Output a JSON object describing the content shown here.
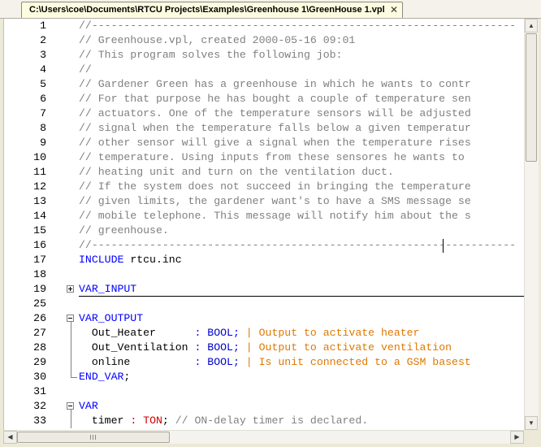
{
  "tab": {
    "title": "C:\\Users\\coe\\Documents\\RTCU Projects\\Examples\\Greenhouse 1\\GreenHouse 1.vpl",
    "close_glyph": "✕"
  },
  "editor": {
    "lines": [
      {
        "num": "1",
        "fold": "none",
        "tokens": [
          {
            "c": "comment",
            "t": "//------------------------------------------------------------------"
          }
        ]
      },
      {
        "num": "2",
        "fold": "none",
        "tokens": [
          {
            "c": "comment",
            "t": "// Greenhouse.vpl, created 2000-05-16 09:01"
          }
        ]
      },
      {
        "num": "3",
        "fold": "none",
        "tokens": [
          {
            "c": "comment",
            "t": "// This program solves the following job:"
          }
        ]
      },
      {
        "num": "4",
        "fold": "none",
        "tokens": [
          {
            "c": "comment",
            "t": "//"
          }
        ]
      },
      {
        "num": "5",
        "fold": "none",
        "tokens": [
          {
            "c": "comment",
            "t": "// Gardener Green has a greenhouse in which he wants to contr"
          }
        ]
      },
      {
        "num": "6",
        "fold": "none",
        "tokens": [
          {
            "c": "comment",
            "t": "// For that purpose he has bought a couple of temperature sen"
          }
        ]
      },
      {
        "num": "7",
        "fold": "none",
        "tokens": [
          {
            "c": "comment",
            "t": "// actuators. One of the temperature sensors will be adjusted"
          }
        ]
      },
      {
        "num": "8",
        "fold": "none",
        "tokens": [
          {
            "c": "comment",
            "t": "// signal when the temperature falls below a given temperatur"
          }
        ]
      },
      {
        "num": "9",
        "fold": "none",
        "tokens": [
          {
            "c": "comment",
            "t": "// other sensor will give a signal when the temperature rises"
          }
        ]
      },
      {
        "num": "10",
        "fold": "none",
        "tokens": [
          {
            "c": "comment",
            "t": "// temperature. Using inputs from these sensores he wants to "
          }
        ]
      },
      {
        "num": "11",
        "fold": "none",
        "tokens": [
          {
            "c": "comment",
            "t": "// heating unit and turn on the ventilation duct."
          }
        ]
      },
      {
        "num": "12",
        "fold": "none",
        "tokens": [
          {
            "c": "comment",
            "t": "// If the system does not succeed in bringing the temperature"
          }
        ]
      },
      {
        "num": "13",
        "fold": "none",
        "tokens": [
          {
            "c": "comment",
            "t": "// given limits, the gardener want's to have a SMS message se"
          }
        ]
      },
      {
        "num": "14",
        "fold": "none",
        "tokens": [
          {
            "c": "comment",
            "t": "// mobile telephone. This message will notify him about the s"
          }
        ]
      },
      {
        "num": "15",
        "fold": "none",
        "tokens": [
          {
            "c": "comment",
            "t": "// greenhouse."
          }
        ]
      },
      {
        "num": "16",
        "fold": "none",
        "tokens": [
          {
            "c": "comment",
            "t": "//------------------------------------------------------------------"
          }
        ]
      },
      {
        "num": "17",
        "fold": "none",
        "tokens": [
          {
            "c": "kw",
            "t": "INCLUDE"
          },
          {
            "c": "plain",
            "t": " rtcu.inc"
          }
        ]
      },
      {
        "num": "18",
        "fold": "none",
        "tokens": []
      },
      {
        "num": "19",
        "fold": "plus",
        "rule": true,
        "tokens": [
          {
            "c": "kw",
            "t": "VAR_INPUT"
          }
        ]
      },
      {
        "num": "25",
        "fold": "none",
        "tokens": []
      },
      {
        "num": "26",
        "fold": "minus",
        "tokens": [
          {
            "c": "kw",
            "t": "VAR_OUTPUT"
          }
        ]
      },
      {
        "num": "27",
        "fold": "line",
        "tokens": [
          {
            "c": "plain",
            "t": "  Out_Heater      "
          },
          {
            "c": "kw",
            "t": ":"
          },
          {
            "c": "plain",
            "t": " "
          },
          {
            "c": "type",
            "t": "BOOL"
          },
          {
            "c": "kw",
            "t": ";"
          },
          {
            "c": "plain",
            "t": " "
          },
          {
            "c": "orange",
            "t": "| Output to activate heater"
          }
        ]
      },
      {
        "num": "28",
        "fold": "line",
        "tokens": [
          {
            "c": "plain",
            "t": "  Out_Ventilation "
          },
          {
            "c": "kw",
            "t": ":"
          },
          {
            "c": "plain",
            "t": " "
          },
          {
            "c": "type",
            "t": "BOOL"
          },
          {
            "c": "kw",
            "t": ";"
          },
          {
            "c": "plain",
            "t": " "
          },
          {
            "c": "orange",
            "t": "| Output to activate ventilation"
          }
        ]
      },
      {
        "num": "29",
        "fold": "line",
        "tokens": [
          {
            "c": "plain",
            "t": "  online          "
          },
          {
            "c": "kw",
            "t": ":"
          },
          {
            "c": "plain",
            "t": " "
          },
          {
            "c": "type",
            "t": "BOOL"
          },
          {
            "c": "kw",
            "t": ";"
          },
          {
            "c": "plain",
            "t": " "
          },
          {
            "c": "orange",
            "t": "| Is unit connected to a GSM basest"
          }
        ]
      },
      {
        "num": "30",
        "fold": "end",
        "tokens": [
          {
            "c": "kw",
            "t": "END_VAR"
          },
          {
            "c": "plain",
            "t": ";"
          }
        ]
      },
      {
        "num": "31",
        "fold": "none",
        "tokens": []
      },
      {
        "num": "32",
        "fold": "minus",
        "tokens": [
          {
            "c": "kw",
            "t": "VAR"
          }
        ]
      },
      {
        "num": "33",
        "fold": "line",
        "tokens": [
          {
            "c": "plain",
            "t": "  timer "
          },
          {
            "c": "red",
            "t": ":"
          },
          {
            "c": "plain",
            "t": " "
          },
          {
            "c": "red",
            "t": "TON"
          },
          {
            "c": "plain",
            "t": "; "
          },
          {
            "c": "comment",
            "t": "// ON-delay timer is declared."
          }
        ]
      }
    ]
  },
  "scroll": {
    "up_glyph": "▲",
    "down_glyph": "▼",
    "left_glyph": "◀",
    "right_glyph": "▶"
  },
  "colors": {
    "comment": "#808080",
    "keyword": "#0000ff",
    "orange_comment": "#e07800",
    "red": "#cc0000"
  }
}
